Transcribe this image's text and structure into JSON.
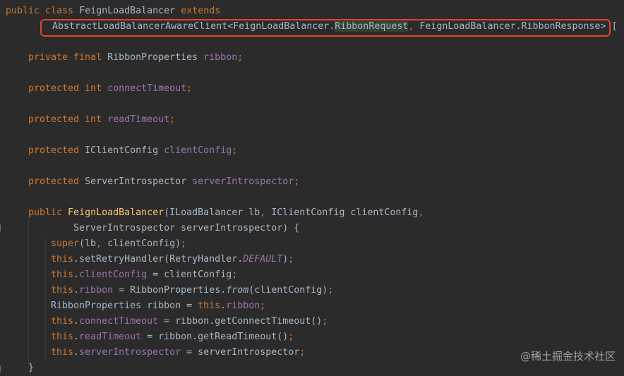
{
  "lines": [
    {
      "indent": 8,
      "tokens": [
        {
          "t": "public class ",
          "c": "kw"
        },
        {
          "t": "FeignLoadBalancer ",
          "c": "cls"
        },
        {
          "t": "extends",
          "c": "kw"
        }
      ]
    },
    {
      "indent": 74,
      "tokens": [
        {
          "t": "AbstractLoadBalancerAwareClient<FeignLoadBalancer.",
          "c": "cls"
        },
        {
          "t": "RibbonRequest",
          "c": "cls hl-green"
        },
        {
          "t": ", ",
          "c": "punct"
        },
        {
          "t": "FeignLoadBalancer.RibbonResponse> ",
          "c": "cls"
        },
        {
          "t": "[",
          "c": "cls"
        }
      ]
    },
    {
      "indent": 40,
      "tokens": []
    },
    {
      "indent": 40,
      "tokens": [
        {
          "t": "private final ",
          "c": "kw"
        },
        {
          "t": "RibbonProperties ",
          "c": "cls"
        },
        {
          "t": "ribbon",
          "c": "field"
        },
        {
          "t": ";",
          "c": "punct"
        }
      ]
    },
    {
      "indent": 40,
      "tokens": []
    },
    {
      "indent": 40,
      "tokens": [
        {
          "t": "protected int ",
          "c": "kw"
        },
        {
          "t": "connectTimeout",
          "c": "field"
        },
        {
          "t": ";",
          "c": "punct"
        }
      ]
    },
    {
      "indent": 40,
      "tokens": []
    },
    {
      "indent": 40,
      "tokens": [
        {
          "t": "protected int ",
          "c": "kw"
        },
        {
          "t": "readTimeout",
          "c": "field"
        },
        {
          "t": ";",
          "c": "punct"
        }
      ]
    },
    {
      "indent": 40,
      "tokens": []
    },
    {
      "indent": 40,
      "tokens": [
        {
          "t": "protected ",
          "c": "kw"
        },
        {
          "t": "IClientConfig ",
          "c": "cls"
        },
        {
          "t": "clientConfig",
          "c": "field"
        },
        {
          "t": ";",
          "c": "punct"
        }
      ]
    },
    {
      "indent": 40,
      "tokens": []
    },
    {
      "indent": 40,
      "tokens": [
        {
          "t": "protected ",
          "c": "kw"
        },
        {
          "t": "ServerIntrospector ",
          "c": "cls"
        },
        {
          "t": "serverIntrospector",
          "c": "field"
        },
        {
          "t": ";",
          "c": "punct"
        }
      ]
    },
    {
      "indent": 40,
      "tokens": []
    },
    {
      "indent": 40,
      "tokens": [
        {
          "t": "public ",
          "c": "kw"
        },
        {
          "t": "FeignLoadBalancer",
          "c": "fn"
        },
        {
          "t": "(ILoadBalancer lb",
          "c": "cls"
        },
        {
          "t": ", ",
          "c": "punct"
        },
        {
          "t": "IClientConfig clientConfig",
          "c": "cls"
        },
        {
          "t": ",",
          "c": "punct"
        }
      ]
    },
    {
      "indent": 104,
      "tokens": [
        {
          "t": "ServerIntrospector serverIntrospector) {",
          "c": "cls"
        }
      ]
    },
    {
      "indent": 72,
      "tokens": [
        {
          "t": "super",
          "c": "kw"
        },
        {
          "t": "(lb",
          "c": "cls"
        },
        {
          "t": ", ",
          "c": "punct"
        },
        {
          "t": "clientConfig)",
          "c": "cls"
        },
        {
          "t": ";",
          "c": "punct"
        }
      ]
    },
    {
      "indent": 72,
      "tokens": [
        {
          "t": "this",
          "c": "kw"
        },
        {
          "t": ".setRetryHandler(RetryHandler.",
          "c": "cls"
        },
        {
          "t": "DEFAULT",
          "c": "field italic"
        },
        {
          "t": ")",
          "c": "cls"
        },
        {
          "t": ";",
          "c": "punct"
        }
      ]
    },
    {
      "indent": 72,
      "tokens": [
        {
          "t": "this",
          "c": "kw"
        },
        {
          "t": ".",
          "c": "cls"
        },
        {
          "t": "clientConfig",
          "c": "field"
        },
        {
          "t": " = clientConfig",
          "c": "cls"
        },
        {
          "t": ";",
          "c": "punct"
        }
      ]
    },
    {
      "indent": 72,
      "tokens": [
        {
          "t": "this",
          "c": "kw"
        },
        {
          "t": ".",
          "c": "cls"
        },
        {
          "t": "ribbon",
          "c": "field"
        },
        {
          "t": " = RibbonProperties.",
          "c": "cls"
        },
        {
          "t": "from",
          "c": "cls italic"
        },
        {
          "t": "(clientConfig)",
          "c": "cls"
        },
        {
          "t": ";",
          "c": "punct"
        }
      ]
    },
    {
      "indent": 72,
      "tokens": [
        {
          "t": "RibbonProperties ribbon = ",
          "c": "cls"
        },
        {
          "t": "this",
          "c": "kw"
        },
        {
          "t": ".",
          "c": "cls"
        },
        {
          "t": "ribbon",
          "c": "field"
        },
        {
          "t": ";",
          "c": "punct"
        }
      ]
    },
    {
      "indent": 72,
      "tokens": [
        {
          "t": "this",
          "c": "kw"
        },
        {
          "t": ".",
          "c": "cls"
        },
        {
          "t": "connectTimeout",
          "c": "field"
        },
        {
          "t": " = ribbon.getConnectTimeout()",
          "c": "cls"
        },
        {
          "t": ";",
          "c": "punct"
        }
      ]
    },
    {
      "indent": 72,
      "tokens": [
        {
          "t": "this",
          "c": "kw"
        },
        {
          "t": ".",
          "c": "cls"
        },
        {
          "t": "readTimeout",
          "c": "field"
        },
        {
          "t": " = ribbon.getReadTimeout()",
          "c": "cls"
        },
        {
          "t": ";",
          "c": "punct"
        }
      ]
    },
    {
      "indent": 72,
      "tokens": [
        {
          "t": "this",
          "c": "kw"
        },
        {
          "t": ".",
          "c": "cls"
        },
        {
          "t": "serverIntrospector",
          "c": "field"
        },
        {
          "t": " = serverIntrospector",
          "c": "cls"
        },
        {
          "t": ";",
          "c": "punct"
        }
      ]
    },
    {
      "indent": 40,
      "tokens": [
        {
          "t": "}",
          "c": "cls"
        }
      ]
    }
  ],
  "watermark": "@稀土掘金技术社区"
}
